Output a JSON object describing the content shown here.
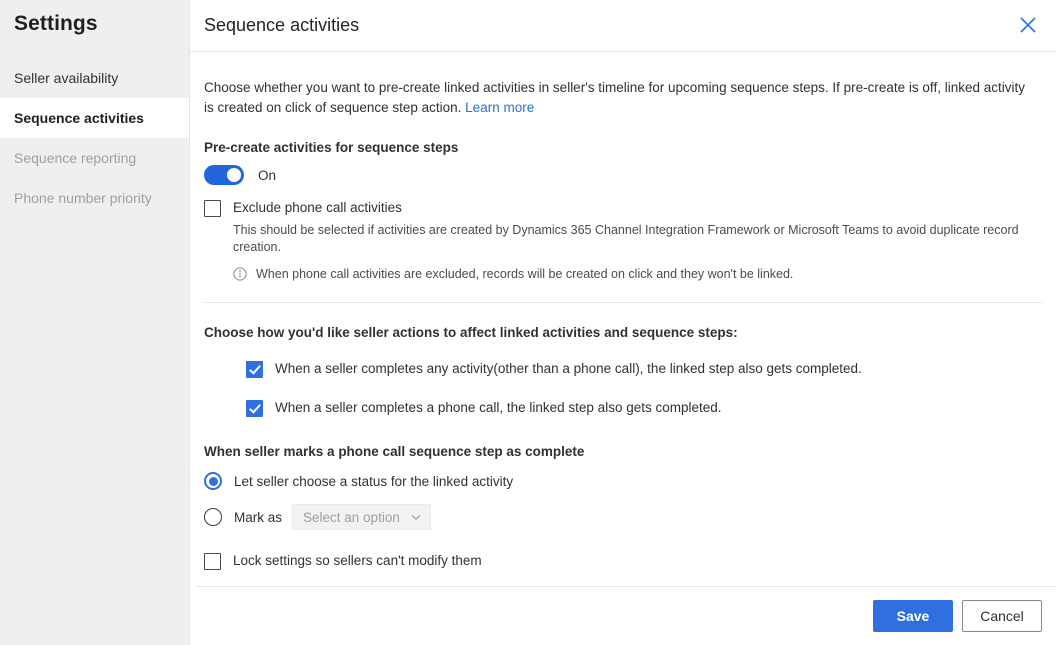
{
  "sidebar": {
    "title": "Settings",
    "items": [
      {
        "label": "Seller availability",
        "state": "normal"
      },
      {
        "label": "Sequence activities",
        "state": "selected"
      },
      {
        "label": "Sequence reporting",
        "state": "disabled"
      },
      {
        "label": "Phone number priority",
        "state": "disabled"
      }
    ]
  },
  "panel": {
    "title": "Sequence activities",
    "close_icon": "close-icon",
    "description": "Choose whether you want to pre-create linked activities in seller's timeline for upcoming sequence steps. If pre-create is off, linked activity is created on click of sequence step action.",
    "learn_more": "Learn more"
  },
  "precreate": {
    "label": "Pre-create activities for sequence steps",
    "toggle_state": "On",
    "toggle_value": true
  },
  "exclude": {
    "label": "Exclude phone call activities",
    "checked": false,
    "description": "This should be selected if activities are created by Dynamics 365 Channel Integration Framework or Microsoft Teams to avoid duplicate record creation.",
    "info_icon": "info-icon",
    "info_text": "When phone call activities are excluded, records will be created on click and they won't be linked."
  },
  "seller_actions": {
    "heading": "Choose how you'd like seller actions to affect linked activities and sequence steps:",
    "options": [
      {
        "label": "When a seller completes any activity(other than a phone call), the linked step also gets completed.",
        "checked": true
      },
      {
        "label": "When a seller completes a phone call, the linked step also gets completed.",
        "checked": true
      }
    ]
  },
  "phone_complete": {
    "heading": "When seller marks a phone call sequence step as complete",
    "options": [
      {
        "label": "Let seller choose a status for the linked activity",
        "selected": true
      },
      {
        "label": "Mark as",
        "selected": false
      }
    ],
    "dropdown": {
      "placeholder": "Select an option",
      "value": "Select an option",
      "chevron_icon": "chevron-down-icon"
    }
  },
  "lock": {
    "label": "Lock settings so sellers can't modify them",
    "checked": false
  },
  "footer": {
    "save_label": "Save",
    "cancel_label": "Cancel"
  },
  "colors": {
    "accent": "#2f6fe0",
    "toggle_on": "#2266dd",
    "link": "#2b6fd1",
    "sidebar_bg": "#f0efee",
    "disabled_text": "#a19f9d"
  }
}
